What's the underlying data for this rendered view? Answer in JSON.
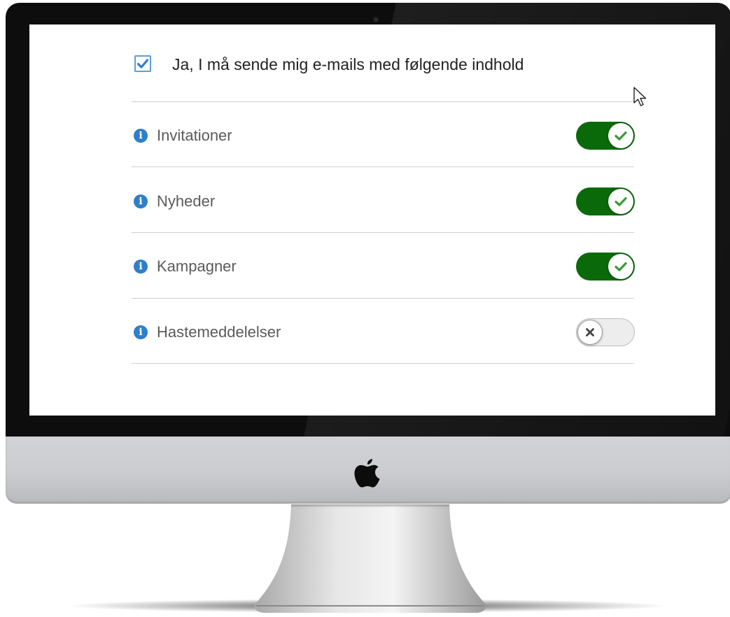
{
  "consent": {
    "checked": true,
    "label": "Ja, I må sende mig e-mails med følgende indhold"
  },
  "preferences": [
    {
      "label": "Invitationer",
      "enabled": true
    },
    {
      "label": "Nyheder",
      "enabled": true
    },
    {
      "label": "Kampagner",
      "enabled": true
    },
    {
      "label": "Hastemeddelelser",
      "enabled": false
    }
  ],
  "icons": {
    "info": "info-icon",
    "toggle_on": "check-icon",
    "toggle_off": "close-icon",
    "hardware_logo": "apple-logo-icon",
    "pointer": "mouse-cursor-icon"
  },
  "colors": {
    "accent_blue": "#2f7fc8",
    "checkbox_border": "#5aa0dc",
    "toggle_on": "#0a6a0a",
    "toggle_off": "#ededed",
    "check_green": "#3a9a3a"
  }
}
